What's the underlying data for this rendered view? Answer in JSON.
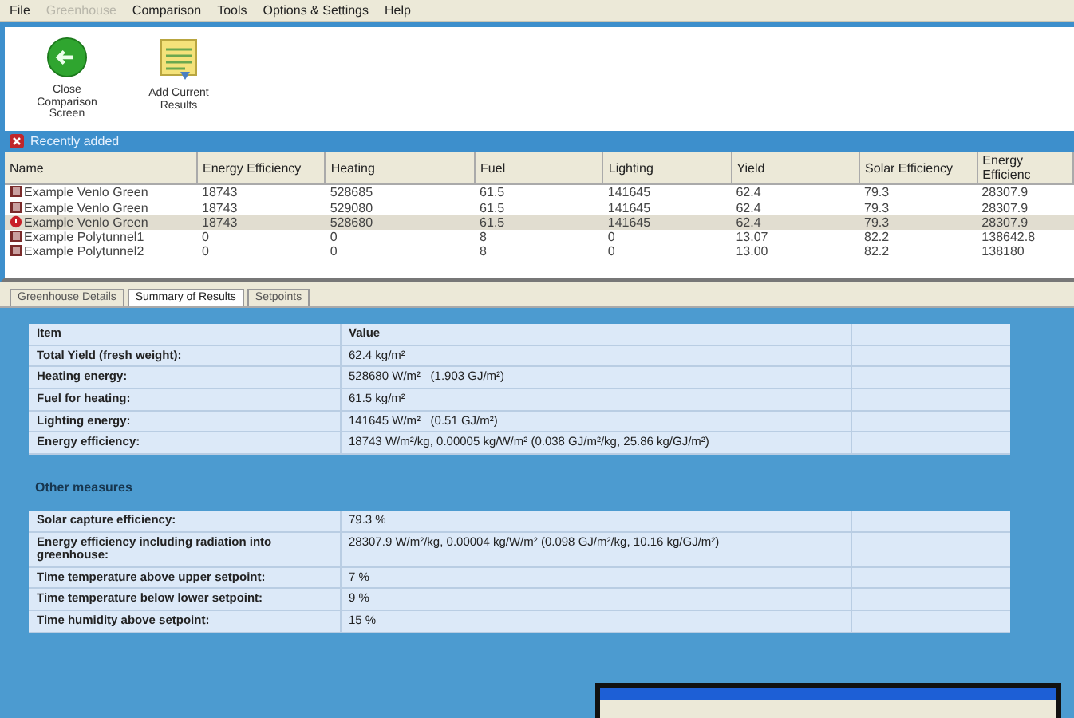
{
  "menu": [
    {
      "label": "File",
      "disabled": false
    },
    {
      "label": "Greenhouse",
      "disabled": true
    },
    {
      "label": "Comparison",
      "disabled": false
    },
    {
      "label": "Tools",
      "disabled": false
    },
    {
      "label": "Options & Settings",
      "disabled": false
    },
    {
      "label": "Help",
      "disabled": false
    }
  ],
  "toolbar": [
    {
      "kind": "close",
      "label": "Close Comparison Screen"
    },
    {
      "kind": "add",
      "label": "Add Current Results"
    }
  ],
  "results_header": {
    "title": "Recently added"
  },
  "grid": {
    "columns": [
      "Name",
      "Energy Efficiency",
      "Heating",
      "Fuel",
      "Lighting",
      "Yield",
      "Solar Efficiency",
      "Energy Efficienc"
    ],
    "rows": [
      {
        "selected": false,
        "cells": [
          "Example Venlo Green",
          "18743",
          "528685",
          "61.5",
          "141645",
          "62.4",
          "79.3",
          "28307.9"
        ]
      },
      {
        "selected": false,
        "cells": [
          "Example Venlo Green",
          "18743",
          "529080",
          "61.5",
          "141645",
          "62.4",
          "79.3",
          "28307.9"
        ]
      },
      {
        "selected": true,
        "cells": [
          "Example Venlo Green",
          "18743",
          "528680",
          "61.5",
          "141645",
          "62.4",
          "79.3",
          "28307.9"
        ]
      },
      {
        "selected": false,
        "cells": [
          "Example Polytunnel1",
          "0",
          "0",
          "8",
          "0",
          "13.07",
          "82.2",
          "138642.8"
        ]
      },
      {
        "selected": false,
        "cells": [
          "Example Polytunnel2",
          "0",
          "0",
          "8",
          "0",
          "13.00",
          "82.2",
          "138180"
        ]
      }
    ]
  },
  "tabs": [
    {
      "label": "Greenhouse Details",
      "selected": false
    },
    {
      "label": "Summary of Results",
      "selected": true
    },
    {
      "label": "Setpoints",
      "selected": false
    }
  ],
  "summary": {
    "columns": [
      "Item",
      "Value"
    ],
    "rows": [
      {
        "label": "Total Yield (fresh weight):",
        "value": "62.4 kg/m²"
      },
      {
        "label": "Heating energy:",
        "value": "528680 W/m²   (1.903 GJ/m²)"
      },
      {
        "label": "Fuel for heating:",
        "value": "61.5 kg/m²"
      },
      {
        "label": "Lighting energy:",
        "value": "141645 W/m²   (0.51 GJ/m²)"
      },
      {
        "label": "Energy efficiency:",
        "value": "18743 W/m²/kg, 0.00005 kg/W/m² (0.038 GJ/m²/kg, 25.86 kg/GJ/m²)"
      }
    ]
  },
  "other_measures": {
    "title": "Other measures",
    "rows": [
      {
        "label": "Solar capture efficiency:",
        "value": "79.3 %"
      },
      {
        "label": "Energy efficiency including radiation into greenhouse:",
        "value": "28307.9 W/m²/kg, 0.00004 kg/W/m² (0.098 GJ/m²/kg, 10.16 kg/GJ/m²)"
      },
      {
        "label": "Time temperature above upper setpoint:",
        "value": "7 %"
      },
      {
        "label": "Time temperature below lower setpoint:",
        "value": "9 %"
      },
      {
        "label": "Time humidity above setpoint:",
        "value": "15 %"
      }
    ]
  }
}
